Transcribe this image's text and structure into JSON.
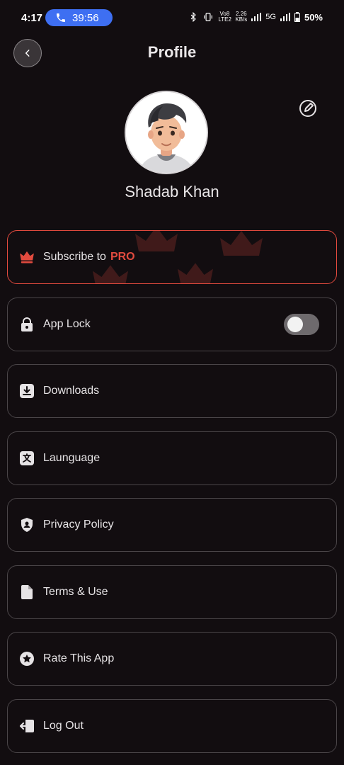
{
  "status_bar": {
    "time": "4:17",
    "call_duration": "39:56",
    "volte": "Vo8 LTE2",
    "net_speed_value": "2.26",
    "net_speed_unit": "KB/s",
    "network": "5G",
    "battery": "50%"
  },
  "header": {
    "title": "Profile"
  },
  "profile": {
    "name": "Shadab Khan"
  },
  "subscribe": {
    "label": "Subscribe to",
    "highlight": "PRO",
    "accent": "#e24b3f"
  },
  "menu": [
    {
      "label": "App Lock",
      "icon": "lock-icon",
      "toggle": false
    },
    {
      "label": "Downloads",
      "icon": "download-icon"
    },
    {
      "label": "Launguage",
      "icon": "translate-icon"
    },
    {
      "label": "Privacy Policy",
      "icon": "privacy-shield-icon"
    },
    {
      "label": "Terms & Use",
      "icon": "document-icon"
    },
    {
      "label": "Rate This App",
      "icon": "star-icon"
    },
    {
      "label": "Log Out",
      "icon": "logout-icon"
    }
  ]
}
